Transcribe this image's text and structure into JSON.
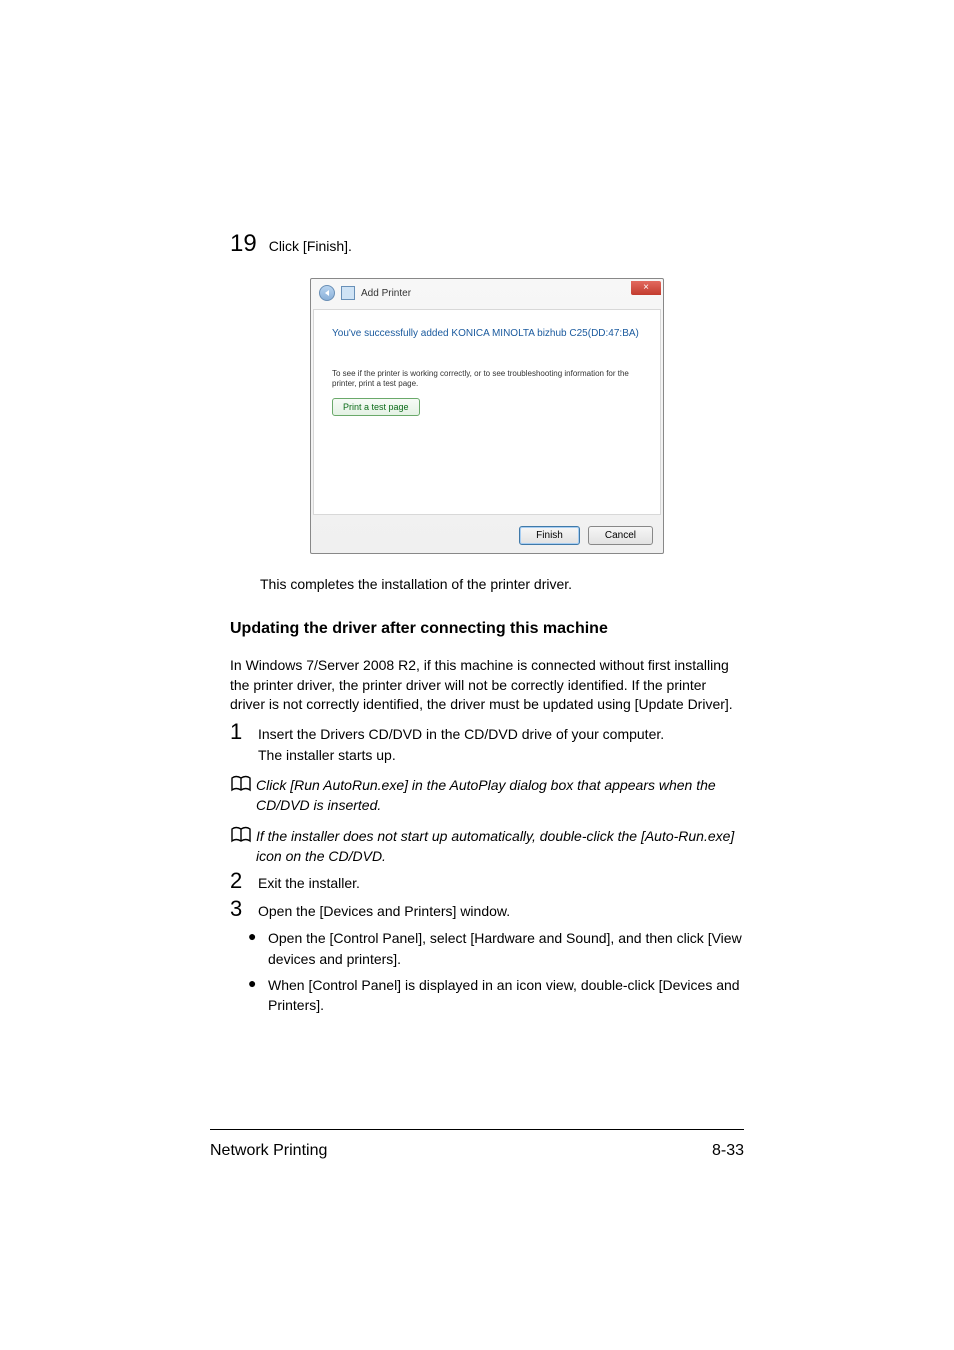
{
  "step19": {
    "num": "19",
    "text": "Click [Finish]."
  },
  "dialog": {
    "title": "Add Printer",
    "close": "×",
    "heading": "You've successfully added KONICA MINOLTA bizhub C25(DD:47:BA)",
    "para": "To see if the printer is working correctly, or to see troubleshooting information for the printer, print a test page.",
    "testbtn": "Print a test page",
    "finish": "Finish",
    "cancel": "Cancel"
  },
  "after_dialog": "This completes the installation of the printer driver.",
  "subheading": "Updating the driver after connecting this machine",
  "intro": "In Windows 7/Server 2008 R2, if this machine is connected without first installing the printer driver, the printer driver will not be correctly identified. If the printer driver is not correctly identified, the driver must be updated using [Update Driver].",
  "steps": [
    {
      "num": "1",
      "txt": "Insert the Drivers CD/DVD in the CD/DVD drive of your computer.",
      "cont": "The installer starts up."
    },
    {
      "num": "2",
      "txt": "Exit the installer."
    },
    {
      "num": "3",
      "txt": "Open the [Devices and Printers] window."
    }
  ],
  "notes": [
    "Click [Run AutoRun.exe] in the AutoPlay dialog box that appears when the CD/DVD is inserted.",
    "If the installer does not start up automatically, double-click the [Auto-Run.exe] icon on the CD/DVD."
  ],
  "bullets": [
    "Open the [Control Panel], select [Hardware and Sound], and then click [View devices and printers].",
    "When [Control Panel] is displayed in an icon view, double-click [Devices and Printers]."
  ],
  "footer": {
    "left": "Network Printing",
    "right": "8-33"
  }
}
